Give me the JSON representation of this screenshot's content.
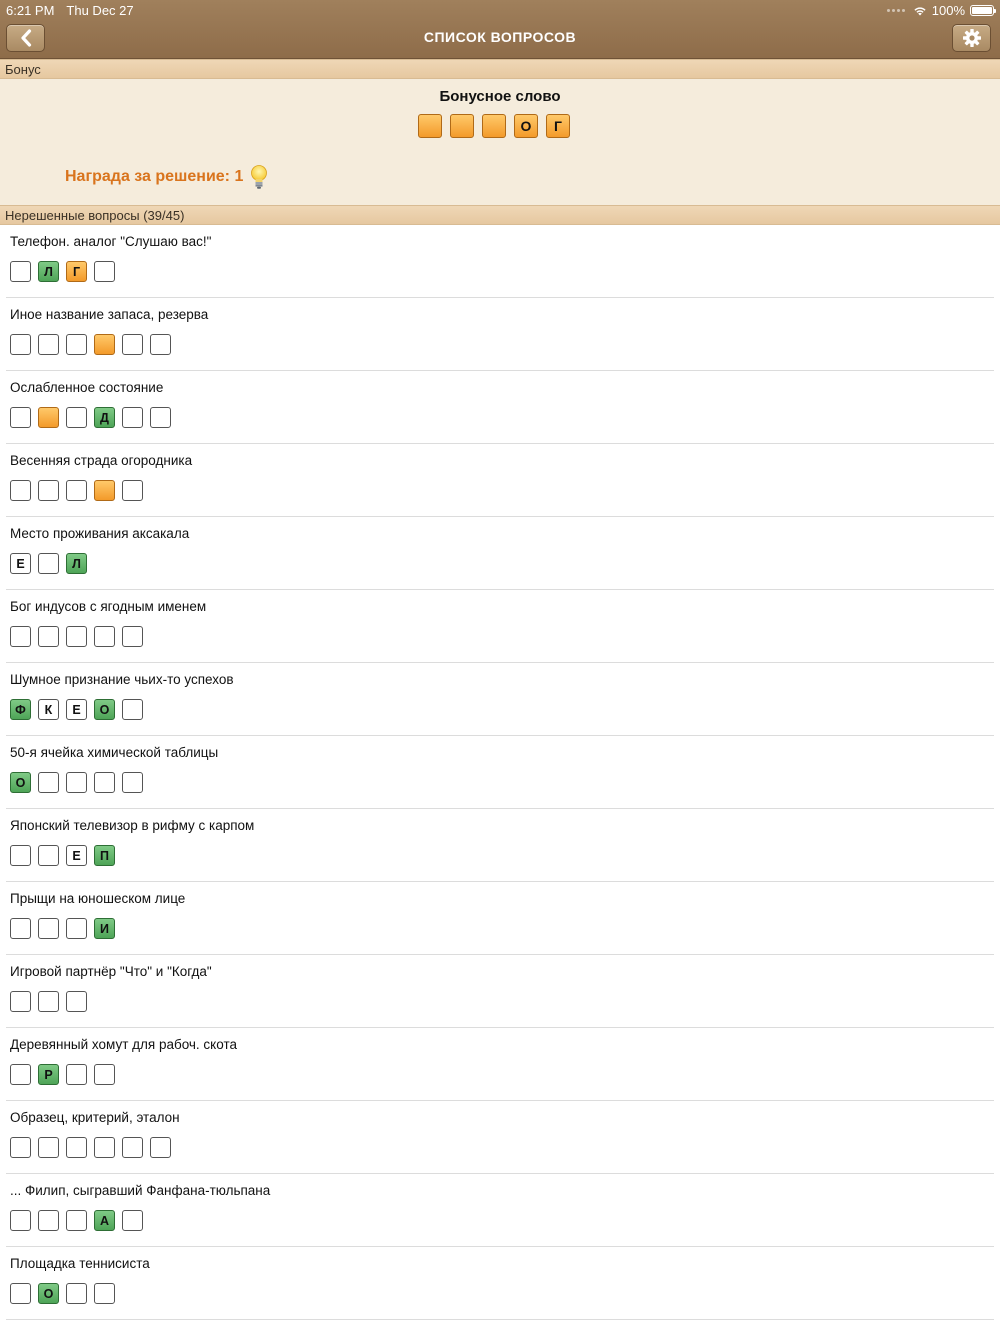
{
  "status": {
    "time": "6:21 PM",
    "date": "Thu Dec 27",
    "battery": "100%"
  },
  "nav": {
    "title": "СПИСОК ВОПРОСОВ"
  },
  "bonus_section": {
    "header": "Бонус",
    "title": "Бонусное слово",
    "cells": [
      "",
      "",
      "",
      "О",
      "Г"
    ],
    "reward": "Награда за решение: 1"
  },
  "unsolved_section": {
    "header": "Нерешенные вопросы (39/45)"
  },
  "questions": [
    {
      "text": "Телефон. аналог \"Слушаю вас!\"",
      "cells": [
        {
          "c": "",
          "s": "empty"
        },
        {
          "c": "Л",
          "s": "green"
        },
        {
          "c": "Г",
          "s": "orange"
        },
        {
          "c": "",
          "s": "empty"
        }
      ]
    },
    {
      "text": "Иное название запаса, резерва",
      "cells": [
        {
          "c": "",
          "s": "empty"
        },
        {
          "c": "",
          "s": "empty"
        },
        {
          "c": "",
          "s": "empty"
        },
        {
          "c": "",
          "s": "orange"
        },
        {
          "c": "",
          "s": "empty"
        },
        {
          "c": "",
          "s": "empty"
        }
      ]
    },
    {
      "text": "Ослабленное состояние",
      "cells": [
        {
          "c": "",
          "s": "empty"
        },
        {
          "c": "",
          "s": "orange"
        },
        {
          "c": "",
          "s": "empty"
        },
        {
          "c": "Д",
          "s": "green"
        },
        {
          "c": "",
          "s": "empty"
        },
        {
          "c": "",
          "s": "empty"
        }
      ]
    },
    {
      "text": "Весенняя страда огородника",
      "cells": [
        {
          "c": "",
          "s": "empty"
        },
        {
          "c": "",
          "s": "empty"
        },
        {
          "c": "",
          "s": "empty"
        },
        {
          "c": "",
          "s": "orange"
        },
        {
          "c": "",
          "s": "empty"
        }
      ]
    },
    {
      "text": "Место проживания аксакала",
      "cells": [
        {
          "c": "Е",
          "s": "letter"
        },
        {
          "c": "",
          "s": "empty"
        },
        {
          "c": "Л",
          "s": "green"
        }
      ]
    },
    {
      "text": "Бог индусов с ягодным именем",
      "cells": [
        {
          "c": "",
          "s": "empty"
        },
        {
          "c": "",
          "s": "empty"
        },
        {
          "c": "",
          "s": "empty"
        },
        {
          "c": "",
          "s": "empty"
        },
        {
          "c": "",
          "s": "empty"
        }
      ]
    },
    {
      "text": "Шумное признание чьих-то успехов",
      "cells": [
        {
          "c": "Ф",
          "s": "green"
        },
        {
          "c": "К",
          "s": "letter"
        },
        {
          "c": "Е",
          "s": "letter"
        },
        {
          "c": "О",
          "s": "green"
        },
        {
          "c": "",
          "s": "empty"
        }
      ]
    },
    {
      "text": "50-я ячейка химической таблицы",
      "cells": [
        {
          "c": "О",
          "s": "green"
        },
        {
          "c": "",
          "s": "empty"
        },
        {
          "c": "",
          "s": "empty"
        },
        {
          "c": "",
          "s": "empty"
        },
        {
          "c": "",
          "s": "empty"
        }
      ]
    },
    {
      "text": "Японский телевизор в рифму с карпом",
      "cells": [
        {
          "c": "",
          "s": "empty"
        },
        {
          "c": "",
          "s": "empty"
        },
        {
          "c": "Е",
          "s": "letter"
        },
        {
          "c": "П",
          "s": "green"
        }
      ]
    },
    {
      "text": "Прыщи на юношеском лице",
      "cells": [
        {
          "c": "",
          "s": "empty"
        },
        {
          "c": "",
          "s": "empty"
        },
        {
          "c": "",
          "s": "empty"
        },
        {
          "c": "И",
          "s": "green"
        }
      ]
    },
    {
      "text": "Игровой партнёр \"Что\" и \"Когда\"",
      "cells": [
        {
          "c": "",
          "s": "empty"
        },
        {
          "c": "",
          "s": "empty"
        },
        {
          "c": "",
          "s": "empty"
        }
      ]
    },
    {
      "text": "Деревянный хомут для рабоч. скота",
      "cells": [
        {
          "c": "",
          "s": "empty"
        },
        {
          "c": "Р",
          "s": "green"
        },
        {
          "c": "",
          "s": "empty"
        },
        {
          "c": "",
          "s": "empty"
        }
      ]
    },
    {
      "text": "Образец, критерий, эталон",
      "cells": [
        {
          "c": "",
          "s": "empty"
        },
        {
          "c": "",
          "s": "empty"
        },
        {
          "c": "",
          "s": "empty"
        },
        {
          "c": "",
          "s": "empty"
        },
        {
          "c": "",
          "s": "empty"
        },
        {
          "c": "",
          "s": "empty"
        }
      ]
    },
    {
      "text": "... Филип, сыгравший Фанфана-тюльпана",
      "cells": [
        {
          "c": "",
          "s": "empty"
        },
        {
          "c": "",
          "s": "empty"
        },
        {
          "c": "",
          "s": "empty"
        },
        {
          "c": "А",
          "s": "green"
        },
        {
          "c": "",
          "s": "empty"
        }
      ]
    },
    {
      "text": "Площадка теннисиста",
      "cells": [
        {
          "c": "",
          "s": "empty"
        },
        {
          "c": "О",
          "s": "green"
        },
        {
          "c": "",
          "s": "empty"
        },
        {
          "c": "",
          "s": "empty"
        }
      ]
    }
  ],
  "colors": {
    "nav_bar": "#8e6c49",
    "section_header": "#e6c8a0",
    "bonus_bg": "#f5ecdc",
    "reward_text": "#d9741d",
    "cell_green": "#4ea457",
    "cell_orange": "#f39a2a"
  },
  "icons": {
    "back": "chevron-left-icon",
    "settings": "gear-icon",
    "reward": "lightbulb-icon",
    "wifi": "wifi-icon",
    "battery": "battery-icon"
  }
}
